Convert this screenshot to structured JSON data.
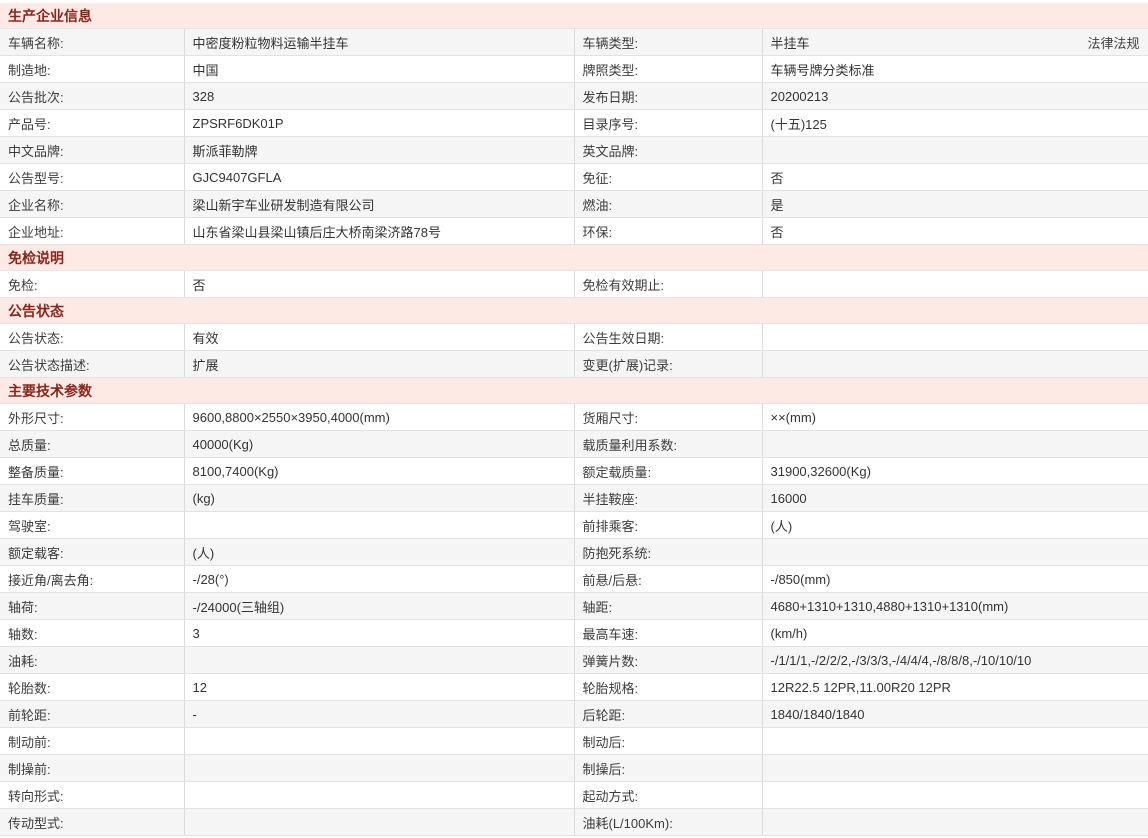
{
  "colors": {
    "section_header_bg": "#fdeae5",
    "section_header_text": "#8b251c",
    "row_stripe": "#f5f5f6",
    "border": "#d9dcdf",
    "text": "#333333"
  },
  "legal_link_label": "法律法规",
  "sections": [
    {
      "title": "生产企业信息",
      "stripe": "odd",
      "rows": [
        {
          "cells": [
            "车辆名称:",
            "中密度粉粒物料运输半挂车",
            "车辆类型:",
            "半挂车"
          ],
          "extra_link": "法律法规"
        },
        {
          "cells": [
            "制造地:",
            "中国",
            "牌照类型:",
            "车辆号牌分类标准"
          ]
        },
        {
          "cells": [
            "公告批次:",
            "328",
            "发布日期:",
            "20200213"
          ]
        },
        {
          "cells": [
            "产品号:",
            "ZPSRF6DK01P",
            "目录序号:",
            "(十五)125"
          ]
        },
        {
          "cells": [
            "中文品牌:",
            "斯派菲勒牌",
            "英文品牌:",
            ""
          ]
        },
        {
          "cells": [
            "公告型号:",
            "GJC9407GFLA",
            "免征:",
            "否"
          ]
        },
        {
          "cells": [
            "企业名称:",
            "梁山新宇车业研发制造有限公司",
            "燃油:",
            "是"
          ]
        },
        {
          "cells": [
            "企业地址:",
            "山东省梁山县梁山镇后庄大桥南梁济路78号",
            "环保:",
            "否"
          ]
        }
      ]
    },
    {
      "title": "免检说明",
      "stripe": "even",
      "rows": [
        {
          "cells": [
            "免检:",
            "否",
            "免检有效期止:",
            ""
          ]
        }
      ]
    },
    {
      "title": "公告状态",
      "stripe": "even",
      "rows": [
        {
          "cells": [
            "公告状态:",
            "有效",
            "公告生效日期:",
            ""
          ]
        },
        {
          "cells": [
            "公告状态描述:",
            "扩展",
            "变更(扩展)记录:",
            ""
          ]
        }
      ]
    },
    {
      "title": "主要技术参数",
      "stripe": "even",
      "rows": [
        {
          "cells": [
            "外形尺寸:",
            "9600,8800×2550×3950,4000(mm)",
            "货厢尺寸:",
            "××(mm)"
          ]
        },
        {
          "cells": [
            "总质量:",
            "40000(Kg)",
            "载质量利用系数:",
            ""
          ]
        },
        {
          "cells": [
            "整备质量:",
            "8100,7400(Kg)",
            "额定载质量:",
            "31900,32600(Kg)"
          ]
        },
        {
          "cells": [
            "挂车质量:",
            "(kg)",
            "半挂鞍座:",
            "16000"
          ]
        },
        {
          "cells": [
            "驾驶室:",
            "",
            "前排乘客:",
            "(人)"
          ]
        },
        {
          "cells": [
            "额定载客:",
            "(人)",
            "防抱死系统:",
            ""
          ]
        },
        {
          "cells": [
            "接近角/离去角:",
            "-/28(°)",
            "前悬/后悬:",
            "-/850(mm)"
          ]
        },
        {
          "cells": [
            "轴荷:",
            "-/24000(三轴组)",
            "轴距:",
            "4680+1310+1310,4880+1310+1310(mm)"
          ]
        },
        {
          "cells": [
            "轴数:",
            "3",
            "最高车速:",
            "(km/h)"
          ]
        },
        {
          "cells": [
            "油耗:",
            "",
            "弹簧片数:",
            "-/1/1/1,-/2/2/2,-/3/3/3,-/4/4/4,-/8/8/8,-/10/10/10"
          ]
        },
        {
          "cells": [
            "轮胎数:",
            "12",
            "轮胎规格:",
            "12R22.5 12PR,11.00R20 12PR"
          ]
        },
        {
          "cells": [
            "前轮距:",
            "-",
            "后轮距:",
            "1840/1840/1840"
          ]
        },
        {
          "cells": [
            "制动前:",
            "",
            "制动后:",
            ""
          ]
        },
        {
          "cells": [
            "制操前:",
            "",
            "制操后:",
            ""
          ]
        },
        {
          "cells": [
            "转向形式:",
            "",
            "起动方式:",
            ""
          ]
        },
        {
          "cells": [
            "传动型式:",
            "",
            "油耗(L/100Km):",
            ""
          ]
        }
      ]
    }
  ]
}
